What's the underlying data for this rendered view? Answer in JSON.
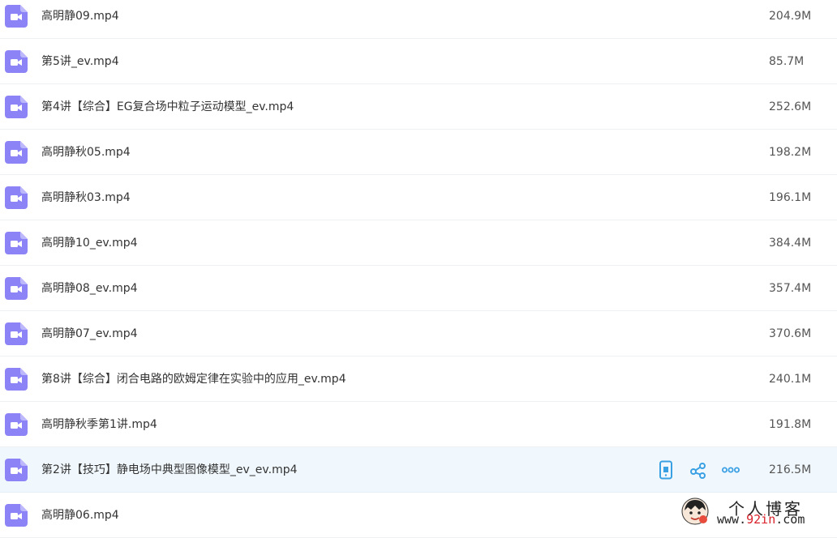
{
  "files": [
    {
      "name": "高明静09.mp4",
      "size": "204.9M"
    },
    {
      "name": "第5讲_ev.mp4",
      "size": "85.7M"
    },
    {
      "name": "第4讲【综合】EG复合场中粒子运动模型_ev.mp4",
      "size": "252.6M"
    },
    {
      "name": "高明静秋05.mp4",
      "size": "198.2M"
    },
    {
      "name": "高明静秋03.mp4",
      "size": "196.1M"
    },
    {
      "name": "高明静10_ev.mp4",
      "size": "384.4M"
    },
    {
      "name": "高明静08_ev.mp4",
      "size": "357.4M"
    },
    {
      "name": "高明静07_ev.mp4",
      "size": "370.6M"
    },
    {
      "name": "第8讲【综合】闭合电路的欧姆定律在实验中的应用_ev.mp4",
      "size": "240.1M"
    },
    {
      "name": "高明静秋季第1讲.mp4",
      "size": "191.8M"
    },
    {
      "name": "第2讲【技巧】静电场中典型图像模型_ev_ev.mp4",
      "size": "216.5M"
    },
    {
      "name": "高明静06.mp4",
      "size": ""
    }
  ],
  "hover_row_index": 10,
  "row_actions": [
    "phone-icon",
    "share-icon",
    "more-icon"
  ],
  "watermark": {
    "title": "个人博客",
    "url_prefix": "www.",
    "url_highlight": "92in",
    "url_suffix": ".com"
  },
  "colors": {
    "video_icon": "#8c84f6",
    "action_icon": "#3aa0e4",
    "hover_bg": "#f1f8fd"
  }
}
